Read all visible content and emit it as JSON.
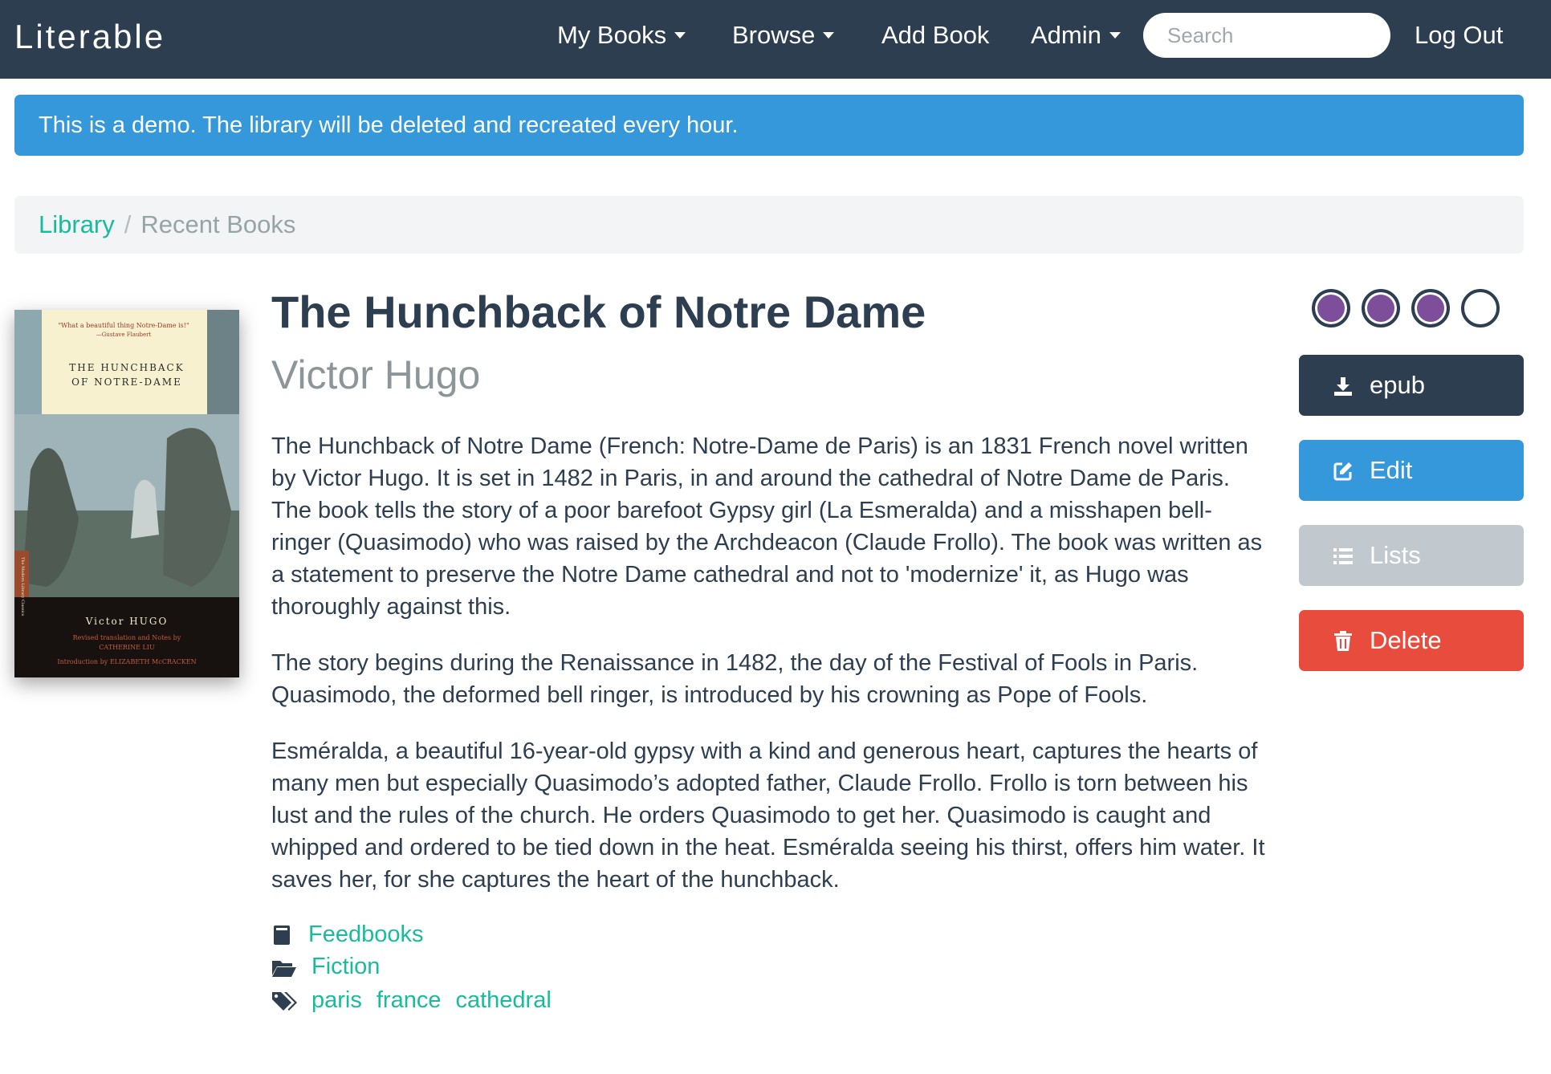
{
  "navbar": {
    "brand": "Literable",
    "my_books": "My Books",
    "browse": "Browse",
    "add_book": "Add Book",
    "admin": "Admin",
    "search_placeholder": "Search",
    "logout": "Log Out"
  },
  "alert": {
    "text": "This is a demo. The library will be deleted and recreated every hour."
  },
  "breadcrumb": {
    "library": "Library",
    "separator": "/",
    "current": "Recent Books"
  },
  "cover": {
    "quote": "\"What a beautiful thing Notre-Dame is!\"",
    "quote_author": "—Gustave Flaubert",
    "title_line1": "THE HUNCHBACK",
    "title_line2": "OF NOTRE-DAME",
    "author": "Victor HUGO",
    "credit1": "Revised translation and Notes by",
    "credit2": "CATHERINE LIU",
    "credit3": "Introduction by ELIZABETH McCRACKEN",
    "series": "The Modern Library Classics"
  },
  "book": {
    "title": "The Hunchback of Notre Dame",
    "author": "Victor Hugo",
    "description": [
      "The Hunchback of Notre Dame (French: Notre-Dame de Paris) is an 1831 French novel written by Victor Hugo. It is set in 1482 in Paris, in and around the cathedral of Notre Dame de Paris. The book tells the story of a poor barefoot Gypsy girl (La Esmeralda) and a misshapen bell-ringer (Quasimodo) who was raised by the Archdeacon (Claude Frollo). The book was written as a statement to preserve the Notre Dame cathedral and not to 'modernize' it, as Hugo was thoroughly against this.",
      "The story begins during the Renaissance in 1482, the day of the Festival of Fools in Paris. Quasimodo, the deformed bell ringer, is introduced by his crowning as Pope of Fools.",
      "Esméralda, a beautiful 16-year-old gypsy with a kind and generous heart, captures the hearts of many men but especially Quasimodo’s adopted father, Claude Frollo. Frollo is torn between his lust and the rules of the church. He orders Quasimodo to get her. Quasimodo is caught and whipped and ordered to be tied down in the heat. Esméralda seeing his thirst, offers him water. It saves her, for she captures the heart of the hunchback."
    ],
    "source": "Feedbooks",
    "category": "Fiction",
    "tags": [
      "paris",
      "france",
      "cathedral"
    ],
    "rating": 3,
    "rating_max": 4
  },
  "actions": {
    "epub": "epub",
    "edit": "Edit",
    "lists": "Lists",
    "delete": "Delete"
  },
  "colors": {
    "navbar": "#2c3e50",
    "alert": "#3498db",
    "link": "#18bc9c",
    "rating_fill": "#7d4e9a",
    "edit": "#3498db",
    "lists": "#c2c9ce",
    "delete": "#e74c3c"
  }
}
